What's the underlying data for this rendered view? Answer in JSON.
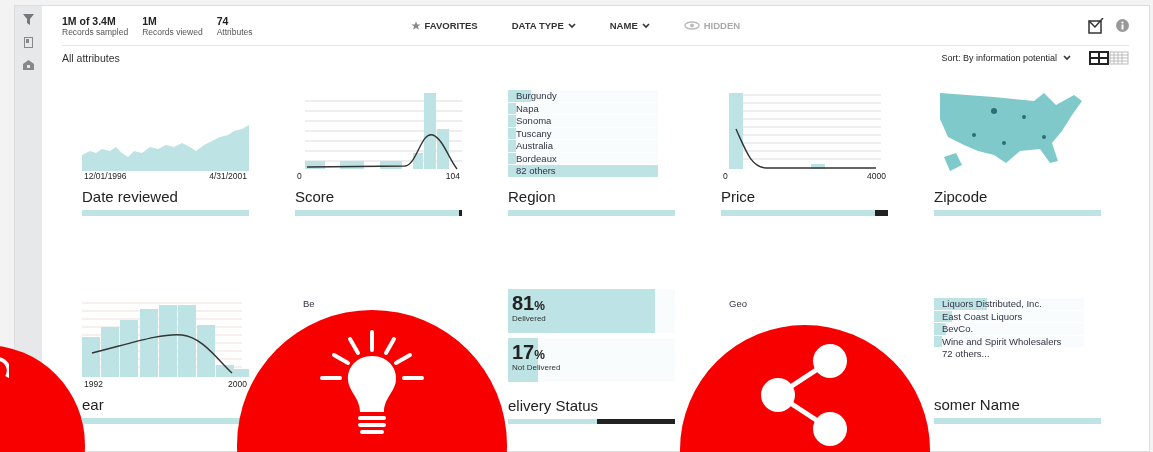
{
  "header": {
    "stats": [
      {
        "value": "1M of 3.4M",
        "label": "Records sampled"
      },
      {
        "value": "1M",
        "label": "Records viewed"
      },
      {
        "value": "74",
        "label": "Attributes"
      }
    ],
    "filters": [
      {
        "label": "FAVORITES",
        "kind": "star",
        "disabled": false
      },
      {
        "label": "DATA TYPE",
        "kind": "dropdown",
        "disabled": false
      },
      {
        "label": "NAME",
        "kind": "dropdown",
        "disabled": false
      },
      {
        "label": "HIDDEN",
        "kind": "eye",
        "disabled": true
      }
    ]
  },
  "view": {
    "title": "All attributes",
    "sort": "Sort: By information potential",
    "modes": [
      {
        "kind": "grid",
        "selected": true
      },
      {
        "kind": "list",
        "selected": false
      }
    ]
  },
  "attributes": [
    {
      "kind": "area",
      "name": "Date reviewed",
      "ticks": [
        "12/01/1996",
        "4/31/2001"
      ],
      "level": 1
    },
    {
      "kind": "histogram",
      "name": "Score",
      "ticks": [
        "0",
        "104"
      ],
      "level": 0.985
    },
    {
      "kind": "bars",
      "name": "Region",
      "items": [
        {
          "label": "Burgundy",
          "level": 0.15
        },
        {
          "label": "Napa",
          "level": 0.05
        },
        {
          "label": "Sonoma",
          "level": 0.05
        },
        {
          "label": "Tuscany",
          "level": 0.05
        },
        {
          "label": "Australia",
          "level": 0.05
        },
        {
          "label": "Bordeaux",
          "level": 0.05
        },
        {
          "label": "82 others",
          "level": 1
        }
      ],
      "level": 1
    },
    {
      "kind": "decay",
      "name": "Price",
      "ticks": [
        "0",
        "4000"
      ],
      "level": 0.92
    },
    {
      "kind": "map",
      "name": "Zipcode",
      "level": 1
    },
    {
      "kind": "year",
      "name": "ear",
      "ticks": [
        "1992",
        "2000"
      ],
      "level": 1
    },
    {
      "kind": "bars",
      "items": [
        {
          "label": "Be"
        }
      ]
    },
    {
      "kind": "percent",
      "name": "elivery Status",
      "items": [
        {
          "value": "81",
          "unit": "%",
          "label": "Delivered",
          "level": 0.88
        },
        {
          "value": "17",
          "unit": "%",
          "label": "Not Delivered",
          "level": 0.18
        }
      ],
      "level": 0.53
    },
    {
      "kind": "bars",
      "items": [
        {
          "label": "Geo"
        }
      ]
    },
    {
      "kind": "bars",
      "name": "somer Name",
      "items": [
        {
          "label": "Liquors Distributed, Inc.",
          "level": 0.35
        },
        {
          "label": "East Coast Liquors",
          "level": 0.12
        },
        {
          "label": "BevCo.",
          "level": 0.08
        },
        {
          "label": "Wine and Spirit Wholesalers",
          "level": 0.05
        },
        {
          "label": "72 others..."
        }
      ],
      "level": 1
    }
  ],
  "overlays": [
    {
      "kind": "refresh"
    },
    {
      "kind": "bulb"
    },
    {
      "kind": "share"
    }
  ]
}
